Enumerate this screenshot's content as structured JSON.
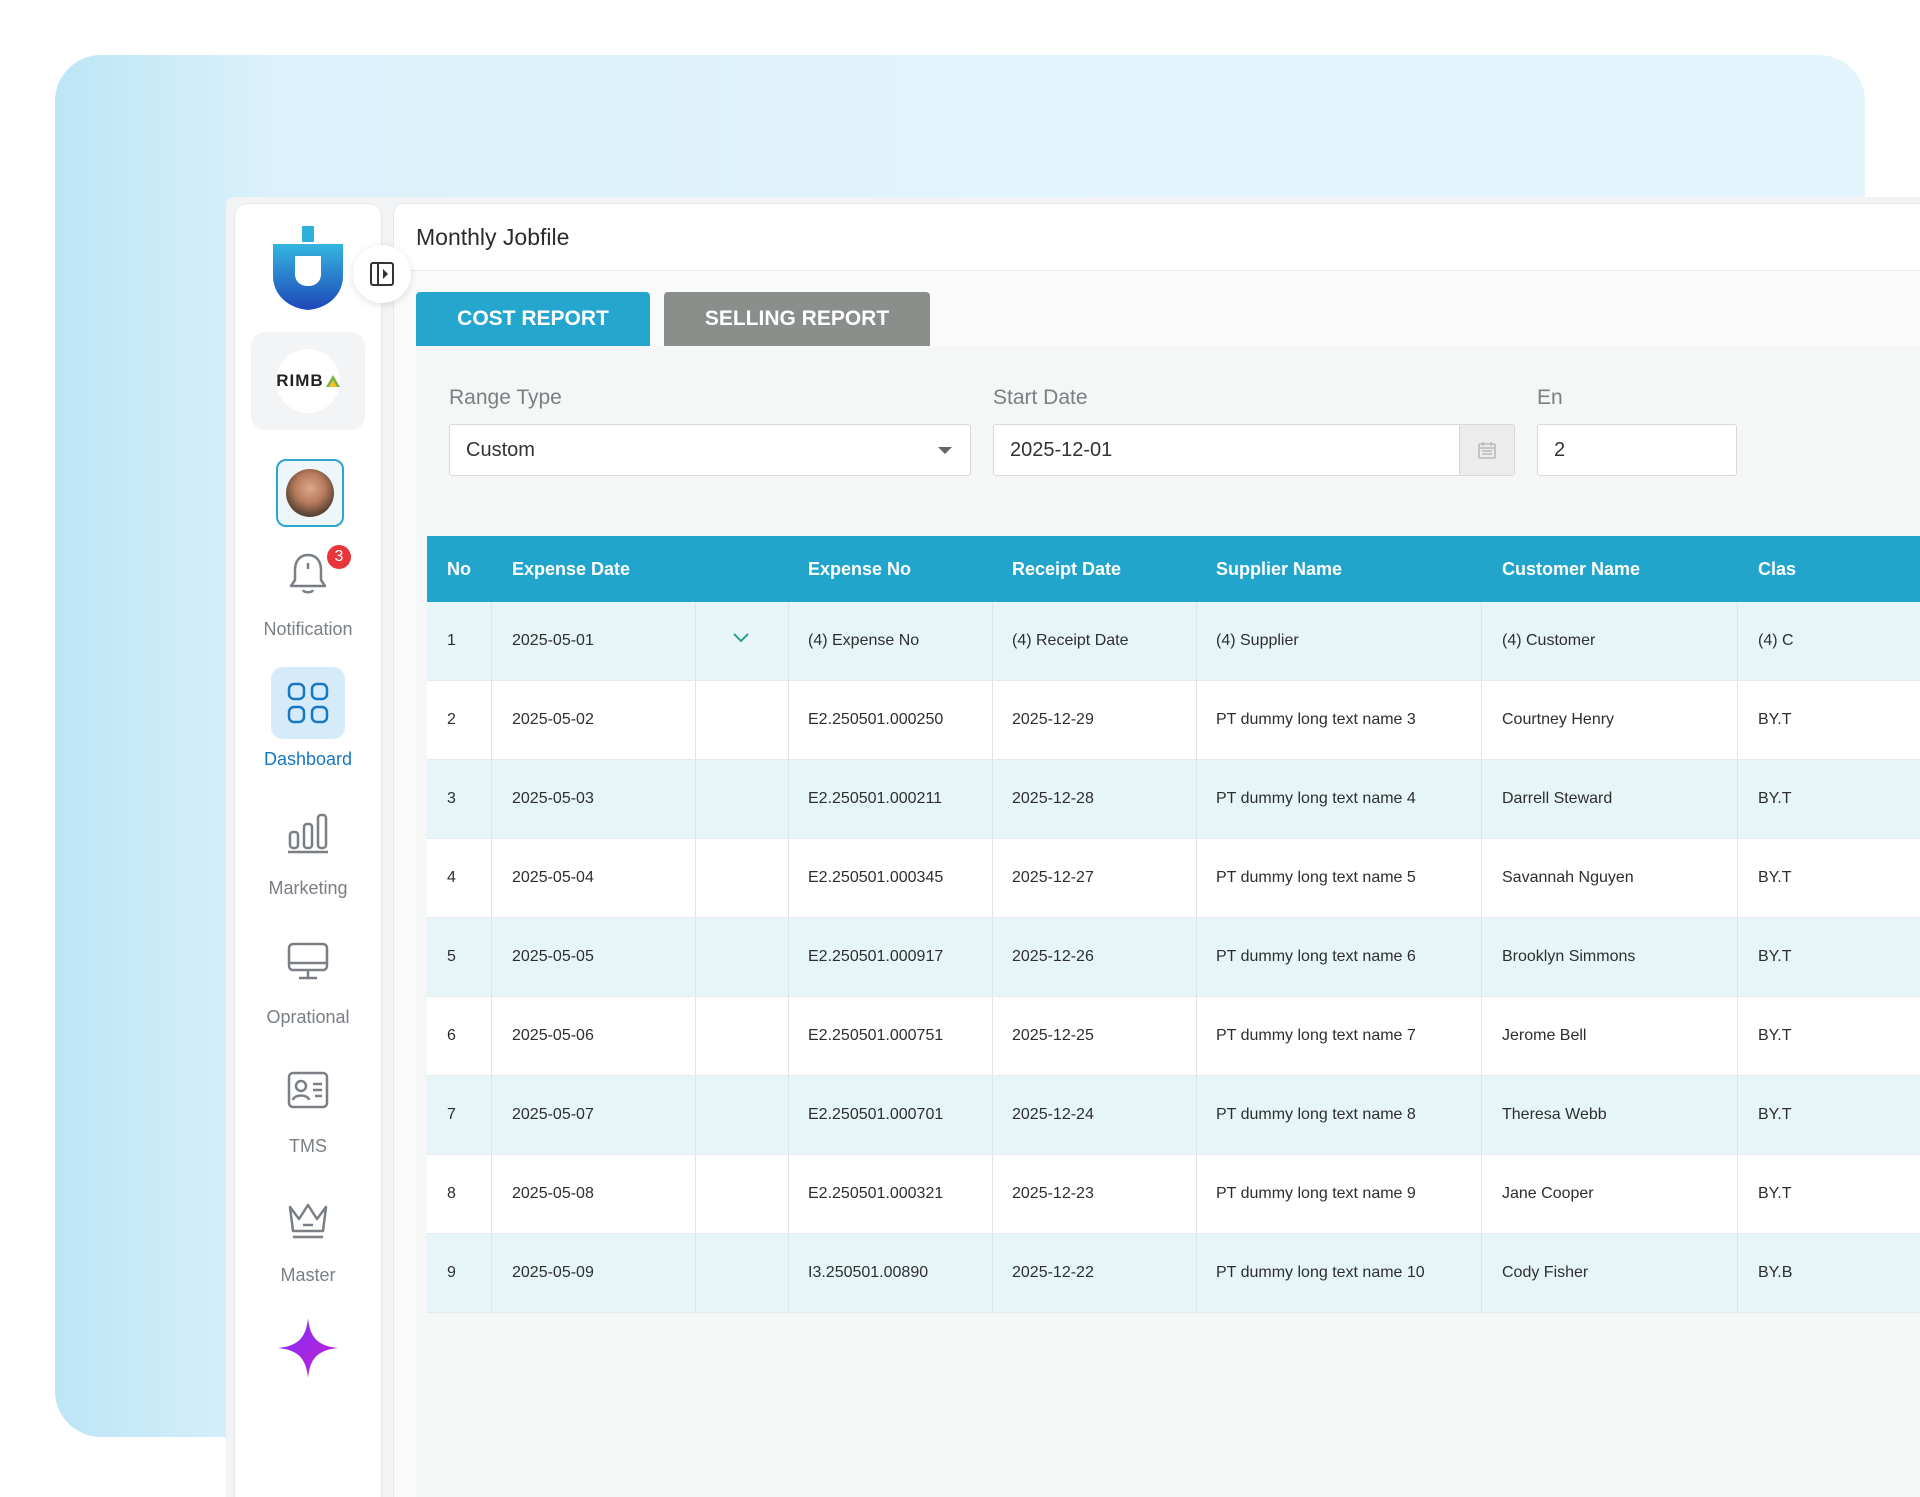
{
  "header": {
    "title": "Monthly Jobfile"
  },
  "sidebar": {
    "company_logo_text": "RIMB",
    "notification_count": "3",
    "items": [
      {
        "label": "Notification",
        "icon": "bell-icon"
      },
      {
        "label": "Dashboard",
        "icon": "grid-icon",
        "active": true
      },
      {
        "label": "Marketing",
        "icon": "bar-chart-icon"
      },
      {
        "label": "Oprational",
        "icon": "monitor-icon"
      },
      {
        "label": "TMS",
        "icon": "id-card-icon"
      },
      {
        "label": "Master",
        "icon": "crown-icon"
      }
    ]
  },
  "tabs": {
    "cost": "COST REPORT",
    "selling": "SELLING REPORT"
  },
  "filters": {
    "range_type_label": "Range Type",
    "range_type_value": "Custom",
    "start_date_label": "Start Date",
    "start_date_value": "2025-12-01",
    "end_date_label": "En",
    "end_date_value": "2"
  },
  "table": {
    "headers": [
      "No",
      "Expense Date",
      "Expense No",
      "Receipt Date",
      "Supplier Name",
      "Customer Name",
      "Clas"
    ],
    "rows": [
      [
        "1",
        "2025-05-01",
        "(4) Expense No",
        "(4) Receipt Date",
        "(4) Supplier",
        "(4) Customer",
        "(4) C"
      ],
      [
        "2",
        "2025-05-02",
        "E2.250501.000250",
        "2025-12-29",
        "PT dummy long text name 3",
        "Courtney Henry",
        "BY.T"
      ],
      [
        "3",
        "2025-05-03",
        "E2.250501.000211",
        "2025-12-28",
        "PT dummy long text name 4",
        "Darrell Steward",
        "BY.T"
      ],
      [
        "4",
        "2025-05-04",
        "E2.250501.000345",
        "2025-12-27",
        "PT dummy long text name 5",
        "Savannah Nguyen",
        "BY.T"
      ],
      [
        "5",
        "2025-05-05",
        "E2.250501.000917",
        "2025-12-26",
        "PT dummy long text name 6",
        "Brooklyn Simmons",
        "BY.T"
      ],
      [
        "6",
        "2025-05-06",
        "E2.250501.000751",
        "2025-12-25",
        "PT dummy long text name 7",
        "Jerome Bell",
        "BY.T"
      ],
      [
        "7",
        "2025-05-07",
        "E2.250501.000701",
        "2025-12-24",
        "PT dummy long text name 8",
        "Theresa Webb",
        "BY.T"
      ],
      [
        "8",
        "2025-05-08",
        "E2.250501.000321",
        "2025-12-23",
        "PT dummy long text name 9",
        "Jane Cooper",
        "BY.T"
      ],
      [
        "9",
        "2025-05-09",
        "I3.250501.00890",
        "2025-12-22",
        "PT dummy long text name 10",
        "Cody Fisher",
        "BY.B"
      ]
    ]
  },
  "colors": {
    "accent": "#22a5cd",
    "tab_inactive": "#8a8f8c",
    "row_alt": "#e6f6f8",
    "active_nav": "#1677c5",
    "badge": "#e8353b"
  }
}
